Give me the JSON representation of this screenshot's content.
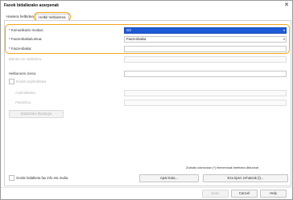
{
  "window": {
    "title": "Faxok bidallarako azarpenak",
    "close_icon": "close-icon"
  },
  "tabs": [
    {
      "label": "Hasiera helbidea"
    },
    {
      "label": "Helbil helbiderea"
    }
  ],
  "form": {
    "komunikazio_modua": {
      "label": "* Komunikazio modua:",
      "value": "G3"
    },
    "faxzenbakia_lekua": {
      "label": "* Faxzenbakia/Lekua:",
      "value": "Faxzenbakia"
    },
    "faxzenbakia": {
      "label": "* Faxzenbakia:",
      "value": ""
    },
    "bairatu_sarbideko": {
      "label": "Bairatu zer sarbidera:",
      "value": ""
    },
    "helbururen_izena": {
      "label": "Helbururen izena:",
      "value": ""
    },
    "erabili_azpihelbidea": {
      "label": "Erabili azpihelbidea"
    },
    "azpihelbidea": {
      "label": "Azpihelbidea:",
      "value": ""
    },
    "pasahitza": {
      "label": "Pasahitza:",
      "value": ""
    },
    "bidali_button": "Bidaltzeko fitxategia",
    "required_note": "Zuzkatu izartxodun (*) elementuak betetzea ditxurtzat",
    "gorde_checkbox": "Gorde bidalketa fax info eta irudia",
    "apat_button": "Apat trata...",
    "eza_button": "Eza tipen zehatzak (i)..."
  },
  "footer": {
    "buttons": [
      "Itxian",
      "Cancel",
      "Help"
    ]
  }
}
